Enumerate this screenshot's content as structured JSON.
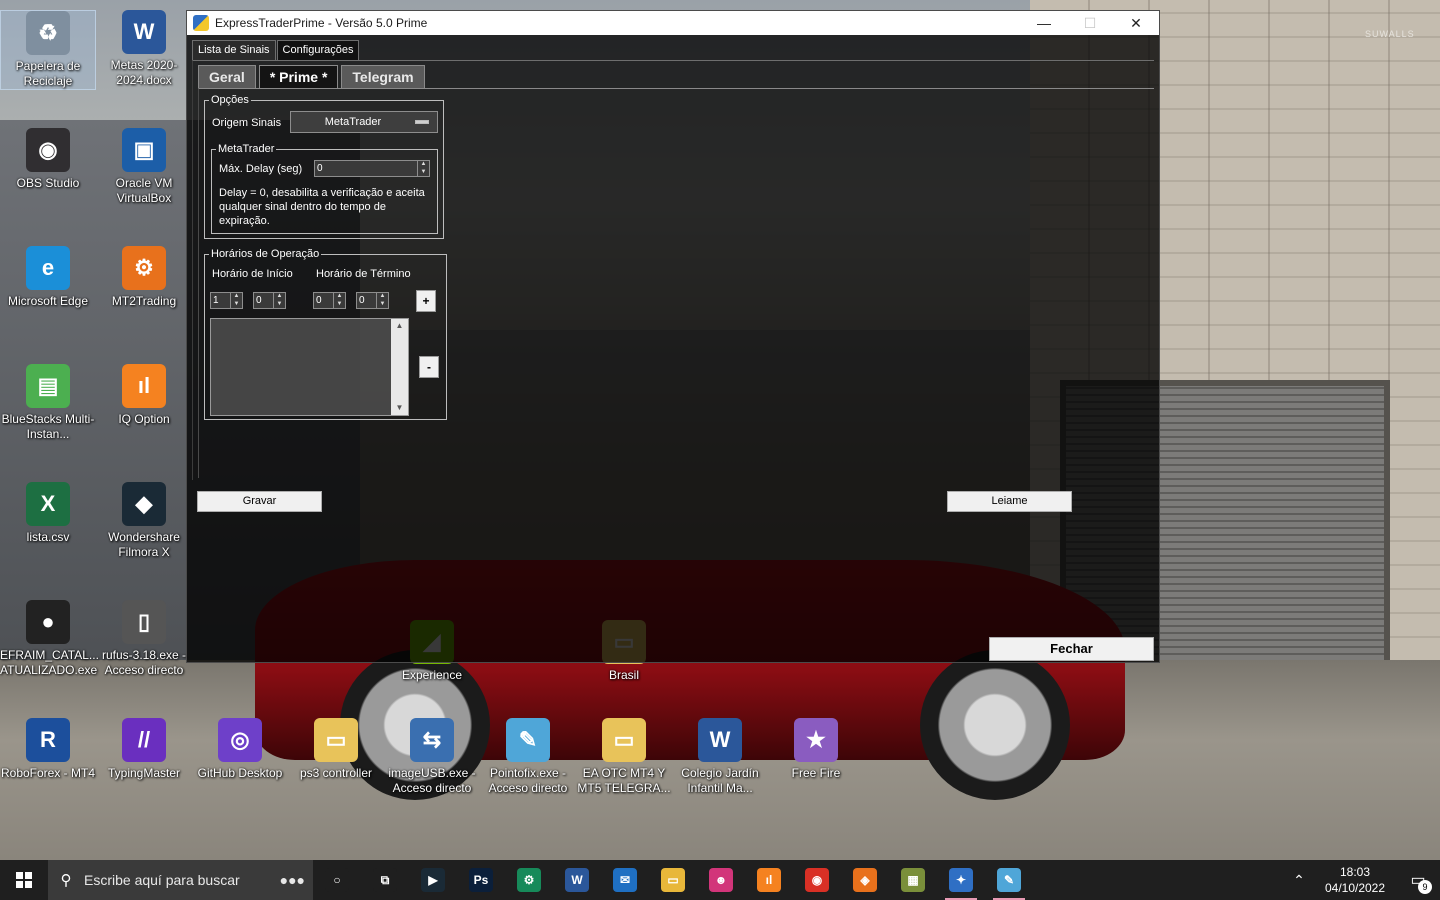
{
  "window": {
    "title": "ExpressTraderPrime - Versão 5.0 Prime",
    "controls": {
      "minimize": "—",
      "maximize": "☐",
      "close": "✕"
    }
  },
  "outer_tabs": [
    "Lista de Sinais",
    "Configurações"
  ],
  "inner_tabs": [
    "Geral",
    "* Prime *",
    "Telegram"
  ],
  "opcoes": {
    "legend": "Opções",
    "origem_label": "Origem Sinais",
    "origem_value": "MetaTrader",
    "metatrader": {
      "legend": "MetaTrader",
      "delay_label": "Máx. Delay (seg)",
      "delay_value": "0",
      "note": "Delay = 0, desabilita a verificação e aceita qualquer sinal dentro do tempo de expiração."
    }
  },
  "horarios": {
    "legend": "Horários de Operação",
    "inicio_label": "Horário de Início",
    "termino_label": "Horário de Término",
    "inicio_hour": "1",
    "inicio_min": "0",
    "termino_hour": "0",
    "termino_min": "0",
    "add_label": "+",
    "remove_label": "-"
  },
  "buttons": {
    "gravar": "Gravar",
    "leiame": "Leiame",
    "fechar": "Fechar"
  },
  "desktop_icons": [
    {
      "label": "Papelera de Reciclaje",
      "icon": "recycle-bin-icon",
      "color": "#7f8f9f"
    },
    {
      "label": "Metas 2020-2024.docx",
      "icon": "word-doc-icon",
      "color": "#2b579a"
    },
    {
      "label": "OBS Studio",
      "icon": "obs-icon",
      "color": "#302e31"
    },
    {
      "label": "Oracle VM VirtualBox",
      "icon": "virtualbox-icon",
      "color": "#1c5ea8"
    },
    {
      "label": "Microsoft Edge",
      "icon": "edge-icon",
      "color": "#1b8fd8"
    },
    {
      "label": "MT2Trading",
      "icon": "mt2trading-icon",
      "color": "#e8711c"
    },
    {
      "label": "BlueStacks Multi-Instan...",
      "icon": "bluestacks-icon",
      "color": "#4caf50"
    },
    {
      "label": "IQ Option",
      "icon": "iqoption-icon",
      "color": "#f58220"
    },
    {
      "label": "lista.csv",
      "icon": "excel-icon",
      "color": "#1d6f42"
    },
    {
      "label": "Wondershare Filmora X",
      "icon": "filmora-icon",
      "color": "#1a2a36"
    },
    {
      "label": "EFRAIM_CATAL... ATUALIZADO.exe",
      "icon": "exe-icon",
      "color": "#222222"
    },
    {
      "label": "rufus-3.18.exe - Acceso directo",
      "icon": "rufus-icon",
      "color": "#555555"
    },
    {
      "label": "RoboForex - MT4",
      "icon": "roboforex-icon",
      "color": "#1c4f9c"
    },
    {
      "label": "TypingMaster",
      "icon": "typingmaster-icon",
      "color": "#6a2fbf"
    },
    {
      "label": "GitHub Desktop",
      "icon": "github-icon",
      "color": "#6e40c9"
    },
    {
      "label": "ps3 controller",
      "icon": "folder-icon",
      "color": "#e8c35a"
    },
    {
      "label": "imageUSB.exe - Acceso directo",
      "icon": "usb-icon",
      "color": "#3a6fb0"
    },
    {
      "label": "Pointofix.exe - Acceso directo",
      "icon": "pointofix-icon",
      "color": "#4fa6d8"
    },
    {
      "label": "EA OTC MT4 Y MT5 TELEGRA...",
      "icon": "folder-icon",
      "color": "#e8c35a"
    },
    {
      "label": "Colegio Jardín Infantil Ma...",
      "icon": "word-doc-icon",
      "color": "#2b579a"
    },
    {
      "label": "Free Fire",
      "icon": "freefire-icon",
      "color": "#8a5cc0"
    },
    {
      "label": "Brasil",
      "icon": "folder-icon",
      "color": "#e8c35a"
    },
    {
      "label": "Experience",
      "icon": "geforce-icon",
      "color": "#76b900"
    }
  ],
  "wallpaper_watermark": "SUWALLS",
  "taskbar": {
    "search_placeholder": "Escribe aquí para buscar",
    "apps": [
      {
        "icon": "cortana-icon",
        "text": "○",
        "color": "#1f1f1f"
      },
      {
        "icon": "task-view-icon",
        "text": "⧉",
        "color": "#1f1f1f"
      },
      {
        "icon": "filmora-taskbar-icon",
        "text": "▶",
        "color": "#1a2a36"
      },
      {
        "icon": "photoshop-icon",
        "text": "Ps",
        "color": "#0b1f3a"
      },
      {
        "icon": "mt2trading-taskbar-icon",
        "text": "⚙",
        "color": "#178a5a"
      },
      {
        "icon": "word-taskbar-icon",
        "text": "W",
        "color": "#2b579a"
      },
      {
        "icon": "mail-icon",
        "text": "✉",
        "color": "#1f6fc2"
      },
      {
        "icon": "file-explorer-icon",
        "text": "▭",
        "color": "#e8b73a"
      },
      {
        "icon": "avatar-app-icon",
        "text": "☻",
        "color": "#d2357a"
      },
      {
        "icon": "iqoption-taskbar-icon",
        "text": "ıl",
        "color": "#f58220"
      },
      {
        "icon": "chrome-icon",
        "text": "◉",
        "color": "#d93025"
      },
      {
        "icon": "avast-browser-icon",
        "text": "◈",
        "color": "#e8711c"
      },
      {
        "icon": "game-app-icon",
        "text": "▦",
        "color": "#7a8f3a"
      },
      {
        "icon": "expresstrader-taskbar-icon",
        "text": "✦",
        "color": "#2f6fc4"
      },
      {
        "icon": "pointofix-taskbar-icon",
        "text": "✎",
        "color": "#4fa6d8"
      }
    ],
    "time": "18:03",
    "date": "04/10/2022",
    "notifications": "9"
  }
}
